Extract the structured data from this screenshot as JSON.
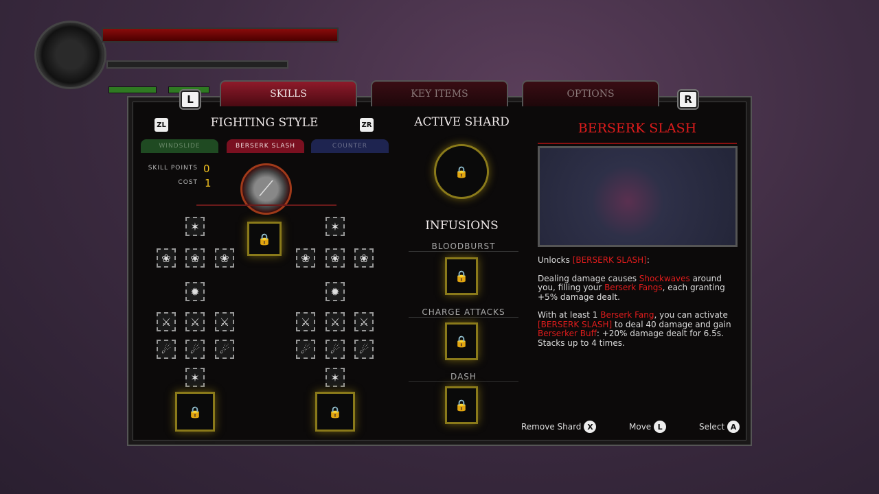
{
  "tabs": {
    "left_key": "L",
    "right_key": "R",
    "items": [
      {
        "label": "SKILLS",
        "active": true
      },
      {
        "label": "KEY ITEMS",
        "active": false
      },
      {
        "label": "OPTIONS",
        "active": false
      }
    ]
  },
  "fighting_style": {
    "title": "FIGHTING STYLE",
    "zl": "ZL",
    "zr": "ZR",
    "styles": [
      {
        "label": "WINDSLIDE",
        "color": "#1f4a22"
      },
      {
        "label": "BERSERK SLASH",
        "color": "#7a1020",
        "active": true
      },
      {
        "label": "COUNTER",
        "color": "#1e2450"
      }
    ],
    "skill_points_label": "SKILL POINTS",
    "skill_points": "0",
    "cost_label": "COST",
    "cost": "1"
  },
  "active_shard": {
    "title": "ACTIVE SHARD",
    "lock_icon": "padlock"
  },
  "infusions": {
    "title": "INFUSIONS",
    "slots": [
      "BLOODBURST",
      "CHARGE ATTACKS",
      "DASH"
    ]
  },
  "detail": {
    "title": "BERSERK SLASH",
    "accent": "#e01c1c",
    "paragraphs": [
      [
        {
          "t": "Unlocks "
        },
        {
          "t": "[BERSERK SLASH]",
          "red": true
        },
        {
          "t": ":"
        }
      ],
      [
        {
          "t": "Dealing damage causes "
        },
        {
          "t": "Shockwaves",
          "red": true
        },
        {
          "t": " around you, filling your "
        },
        {
          "t": "Berserk Fangs",
          "red": true
        },
        {
          "t": ", each granting +5% damage dealt."
        }
      ],
      [
        {
          "t": "With at least 1 "
        },
        {
          "t": "Berserk Fang",
          "red": true
        },
        {
          "t": ", you can activate "
        },
        {
          "t": "[BERSERK SLASH]",
          "red": true
        },
        {
          "t": " to deal 40 damage and gain "
        },
        {
          "t": "Berserker Buff",
          "red": true
        },
        {
          "t": ": +20% damage dealt for 6.5s."
        },
        {
          "t": "\nStacks up to 4 times."
        }
      ]
    ]
  },
  "hints": [
    {
      "label": "Remove Shard",
      "button": "X"
    },
    {
      "label": "Move",
      "button": "L"
    },
    {
      "label": "Select",
      "button": "A"
    }
  ]
}
